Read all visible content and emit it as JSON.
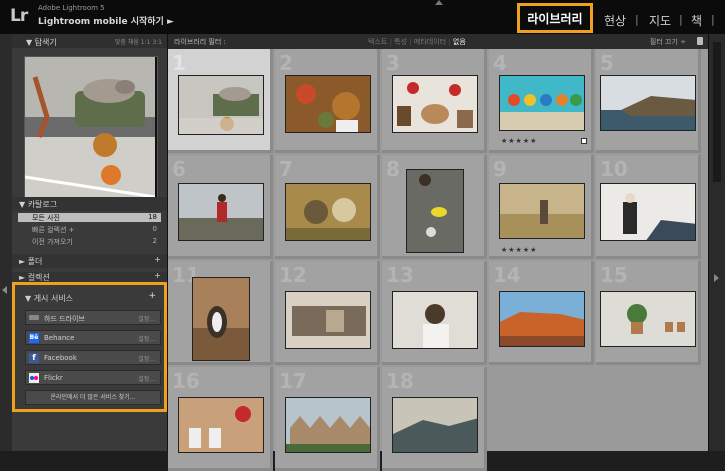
{
  "app": {
    "logo": "Lr",
    "brand": "Adobe Lightroom 5",
    "mobile": "Lightroom mobile 시작하기 ►"
  },
  "modules": {
    "library": "라이브러리",
    "develop": "현상",
    "map": "지도",
    "book": "책",
    "sep": "|"
  },
  "navigator": {
    "title": "▼ 탐색기",
    "zoom": "맞춤 채움 1:1 3:1"
  },
  "catalog": {
    "title": "▼ 카탈로그",
    "rows": [
      {
        "label": "모든 사진",
        "count": "18"
      },
      {
        "label": "빠른 컬렉션 +",
        "count": "0"
      },
      {
        "label": "이전 가져오기",
        "count": "2"
      }
    ]
  },
  "folders": {
    "title": "► 폴더",
    "plus": "+"
  },
  "collections": {
    "title": "► 컬렉션",
    "plus": "+"
  },
  "publish": {
    "title": "▼ 게시 서비스",
    "plus": "+",
    "services": [
      {
        "label": "하드 드라이브",
        "setup": "설정..."
      },
      {
        "label": "Behance",
        "setup": "설정..."
      },
      {
        "label": "Facebook",
        "setup": "설정..."
      },
      {
        "label": "Flickr",
        "setup": "설정..."
      }
    ],
    "more": "온라인에서 더 많은 서비스 찾기..."
  },
  "filter": {
    "title": "라이브러리 필터 :",
    "text": "텍스트",
    "attr": "특성",
    "meta": "메타데이터",
    "none": "없음",
    "off": "필터 끄기 ÷"
  },
  "grid": {
    "numbers": [
      "1",
      "2",
      "3",
      "4",
      "5",
      "6",
      "7",
      "8",
      "9",
      "10",
      "11",
      "12",
      "13",
      "14",
      "15",
      "16",
      "17",
      "18"
    ],
    "stars": "★★★★★"
  }
}
